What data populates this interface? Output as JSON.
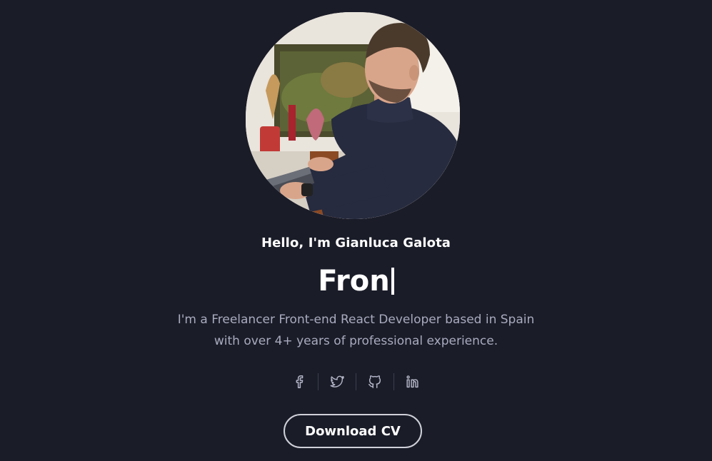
{
  "hero": {
    "greeting": "Hello, I'm Gianluca Galota",
    "typed_text": "Fron",
    "bio_line1": "I'm a Freelancer Front-end React Developer based in Spain",
    "bio_line2": "with over 4+ years of professional experience.",
    "cv_button_label": "Download CV"
  },
  "socials": [
    {
      "icon": "facebook-icon"
    },
    {
      "icon": "twitter-icon"
    },
    {
      "icon": "github-icon"
    },
    {
      "icon": "linkedin-icon"
    }
  ],
  "colors": {
    "background": "#1a1c28",
    "text": "#ffffff",
    "muted_text": "#a9abbf",
    "icon": "#b4b6c8",
    "button_border": "#cfd0d8"
  }
}
